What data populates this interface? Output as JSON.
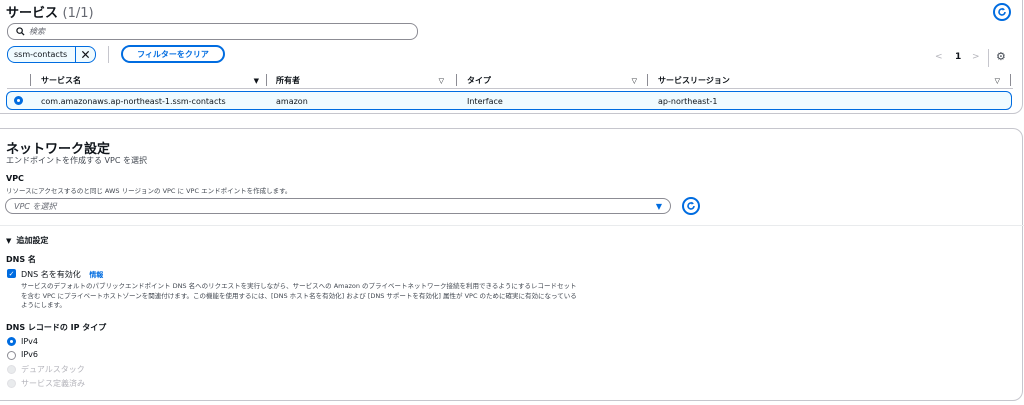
{
  "services": {
    "title": "サービス",
    "count": "(1/1)",
    "search_placeholder": "検索",
    "filter_token": "ssm-contacts",
    "clear_filter_label": "フィルターをクリア",
    "pagination": {
      "prev": "<",
      "current_page": "1",
      "next": ">"
    },
    "columns": [
      "サービス名",
      "所有者",
      "タイプ",
      "サービスリージョン"
    ],
    "rows": [
      {
        "selected": true,
        "service_name": "com.amazonaws.ap-northeast-1.ssm-contacts",
        "owner": "amazon",
        "type": "Interface",
        "region": "ap-northeast-1"
      }
    ]
  },
  "network": {
    "title": "ネットワーク設定",
    "description": "エンドポイントを作成する VPC を選択",
    "vpc_label": "VPC",
    "vpc_description": "リソースにアクセスするのと同じ AWS リージョンの VPC に VPC エンドポイントを作成します。",
    "vpc_placeholder": "VPC を選択"
  },
  "additional": {
    "toggle_label": "追加設定",
    "dns_name_heading": "DNS 名",
    "enable_dns_label": "DNS 名を有効化",
    "info_label": "情報",
    "enable_dns_checked": true,
    "dns_description_lines": [
      "サービスのデフォルトのパブリックエンドポイント DNS 名へのリクエストを実行しながら、サービスへの Amazon のプライベートネットワーク接続を利用できるようにするレコードセット",
      "を含む VPC にプライベートホストゾーンを関連付けます。この機能を使用するには、[DNS ホスト名を有効化] および [DNS サポートを有効化] 属性が VPC のために確実に有効になっている",
      "ようにします。"
    ],
    "ip_type_heading": "DNS レコードの IP タイプ",
    "ip_options": [
      {
        "label": "IPv4",
        "state": "selected"
      },
      {
        "label": "IPv6",
        "state": "enabled"
      },
      {
        "label": "デュアルスタック",
        "state": "disabled"
      },
      {
        "label": "サービス定義済み",
        "state": "disabled"
      }
    ]
  },
  "colors": {
    "accent": "#006ce0",
    "selected_row_bg": "#f0fbff",
    "border": "#c6c6cd",
    "disabled_text": "#b4b4bb"
  }
}
